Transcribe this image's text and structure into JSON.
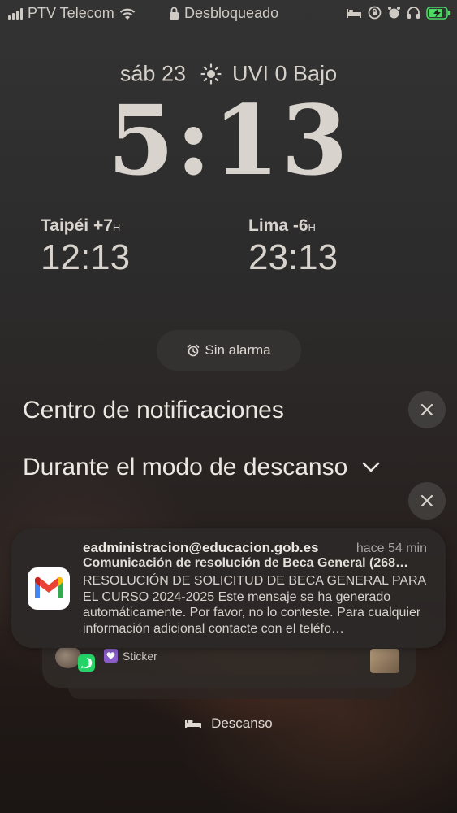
{
  "status_bar": {
    "carrier": "PTV Telecom",
    "lock_state": "Desbloqueado",
    "icons": [
      "signal-icon",
      "wifi-icon",
      "lock-icon",
      "bed-icon",
      "orientation-lock-icon",
      "alarm-icon",
      "headphones-icon",
      "battery-charging-icon"
    ]
  },
  "lock": {
    "date": "sáb 23",
    "weather": "UVI 0 Bajo",
    "time": "5:13"
  },
  "world_clocks": [
    {
      "city": "Taipéi",
      "offset": "+7",
      "unit": "H",
      "time": "12:13"
    },
    {
      "city": "Lima",
      "offset": "-6",
      "unit": "H",
      "time": "23:13"
    }
  ],
  "alarm": {
    "label": "Sin alarma"
  },
  "notification_center": {
    "title": "Centro de notificaciones",
    "group_title": "Durante el modo de descanso"
  },
  "notification": {
    "sender": "eadministracion@educacion.gob.es",
    "time": "hace 54 min",
    "subject": "Comunicación de resolución de Beca General (268…",
    "body": "RESOLUCIÓN DE SOLICITUD DE BECA GENERAL PARA EL CURSO 2024-2025 Este mensaje se ha generado automáticamente. Por favor, no lo conteste. Para cualquier información adicional contacte con el teléfo…"
  },
  "stacked_notification": {
    "preview": "Sticker"
  },
  "focus": {
    "label": "Descanso"
  },
  "colors": {
    "gmail_red": "#EA4335",
    "gmail_blue": "#4285F4",
    "gmail_green": "#34A853",
    "gmail_yellow": "#FBBC04",
    "whatsapp_green": "#25D366",
    "battery_green": "#4cd964"
  }
}
